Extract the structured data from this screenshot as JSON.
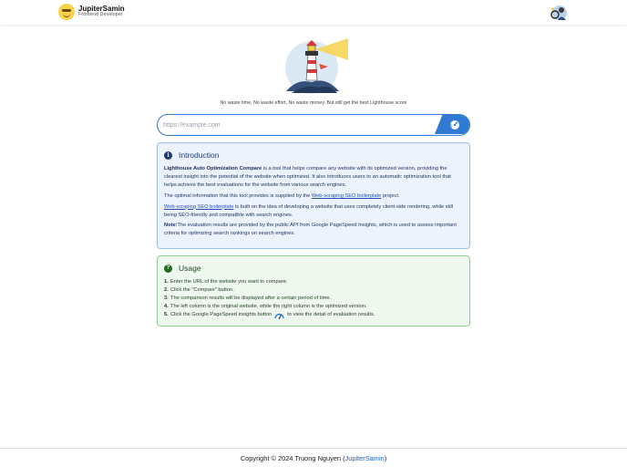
{
  "header": {
    "brand_name": "JupiterSamin",
    "brand_role": "Frontend Developer"
  },
  "hero": {
    "tagline": "No waste time, No waste effort, No waste money. But still get the best Lighthouse score"
  },
  "search": {
    "placeholder": "https://example.com",
    "value": ""
  },
  "intro": {
    "title": "Introduction",
    "p1_bold": "Lighthouse Auto Optimization Compare",
    "p1_rest": " is a tool that helps compare any website with its optimized version, providing the clearest insight into the potential of the website when optimized. It also introduces users to an automatic optimization tool that helps achieve the best evaluations for the website from various search engines.",
    "p2_pre": "The optimal information that this tool provides is supplied by the ",
    "p2_link": "Web-scraping SEO boilerplate",
    "p2_post": " project.",
    "p3_link": "Web-scraping SEO boilerplate",
    "p3_rest": " is built on the idea of developing a website that uses completely client-side rendering, while still being SEO-friendly and compatible with search engines.",
    "note_label": "Note:",
    "note_text": "The evaluation results are provided by the public API from Google PageSpeed Insights, which is used to assess important criteria for optimizing search rankings on search engines."
  },
  "usage": {
    "title": "Usage",
    "steps": [
      {
        "num": "1.",
        "text": "Enter the URL of the website you want to compare."
      },
      {
        "num": "2.",
        "text": "Click the \"Compare\" button."
      },
      {
        "num": "3.",
        "text": "The comparison results will be displayed after a certain period of time."
      },
      {
        "num": "4.",
        "text": "The left column is the original website, while the right column is the optimized version."
      },
      {
        "num": "5.",
        "text_pre": "Click the Google PageSpeed insights button",
        "text_post": "to view the detail of evaluation results."
      }
    ]
  },
  "footer": {
    "copyright": "Copyright © 2024 Truong Nguyen (",
    "author_link": "JupiterSamin",
    "close": ")"
  },
  "icons": {
    "brand": "smiley-logo-icon",
    "avatar": "profile-avatar-icon",
    "hero": "lighthouse-illustration-icon",
    "submit": "pagespeed-gauge-icon",
    "intro": "info-circle-icon",
    "usage": "question-circle-icon"
  },
  "colors": {
    "accent": "#2f7bd3",
    "intro_bg": "#edf3fd",
    "intro_border": "#9dbce8",
    "usage_bg": "#eef8ee",
    "usage_border": "#98cf98"
  }
}
